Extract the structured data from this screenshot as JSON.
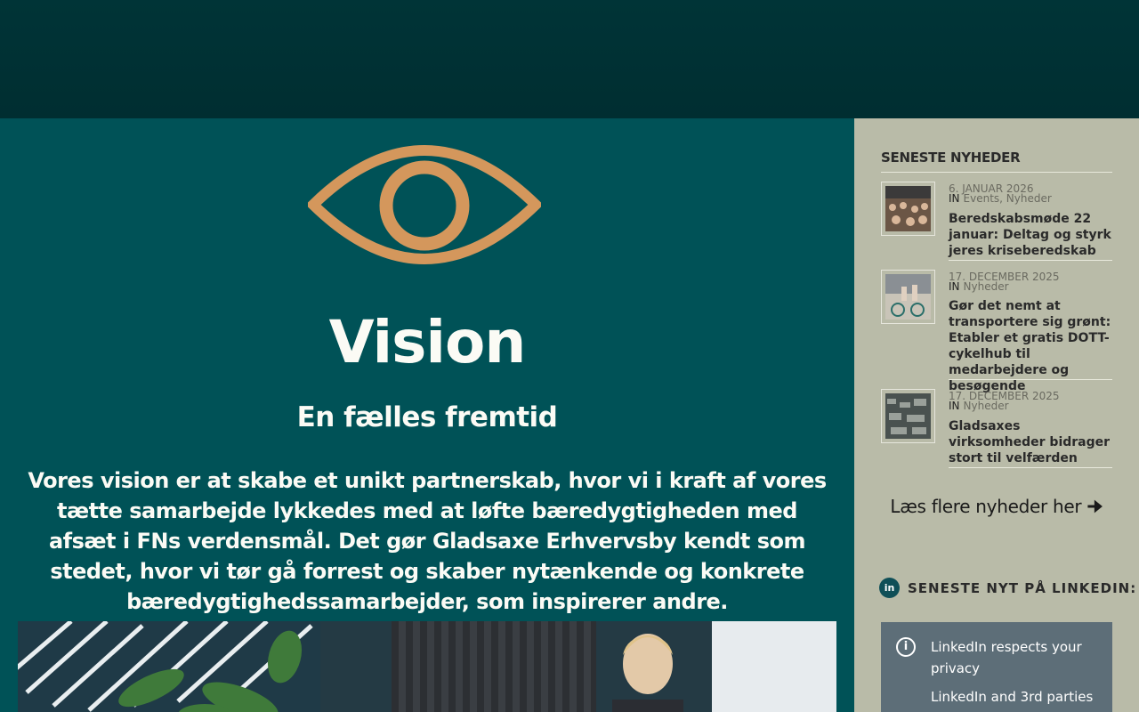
{
  "main": {
    "title": "Vision",
    "subtitle": "En fælles fremtid",
    "body": "Vores vision er at skabe et unikt partnerskab, hvor vi i kraft af vores tætte samarbejde lykkedes med at løfte bæredygtigheden med afsæt i FNs verdensmål. Det gør Gladsaxe Erhvervsby kendt som stedet, hvor vi tør gå forrest og skaber nytænkende og konkrete bæredygtighedssamarbejder, som inspirerer andre.",
    "accent_color": "#d4975c"
  },
  "sidebar": {
    "news_title": "SENESTE NYHEDER",
    "in_label": "IN",
    "news": [
      {
        "date": "6. JANUAR 2026",
        "categories": "Events, Nyheder",
        "title": "Beredskabsmøde 22 januar: Deltag og styrk jeres kriseberedskab"
      },
      {
        "date": "17. DECEMBER 2025",
        "categories": "Nyheder",
        "title": "Gør det nemt at transportere sig grønt: Etabler et gratis DOTT-cykelhub til medarbejdere og besøgende"
      },
      {
        "date": "17. DECEMBER 2025",
        "categories": "Nyheder",
        "title": "Gladsaxes virksomheder bidrager stort til velfærden"
      }
    ],
    "more_link": "Læs flere nyheder her 🠊",
    "linkedin_title": "SENESTE NYT PÅ LINKEDIN:",
    "linkedin_icon_text": "in",
    "linkedin_notice": {
      "line1": "LinkedIn respects your privacy",
      "line2": "LinkedIn and 3rd parties"
    }
  }
}
